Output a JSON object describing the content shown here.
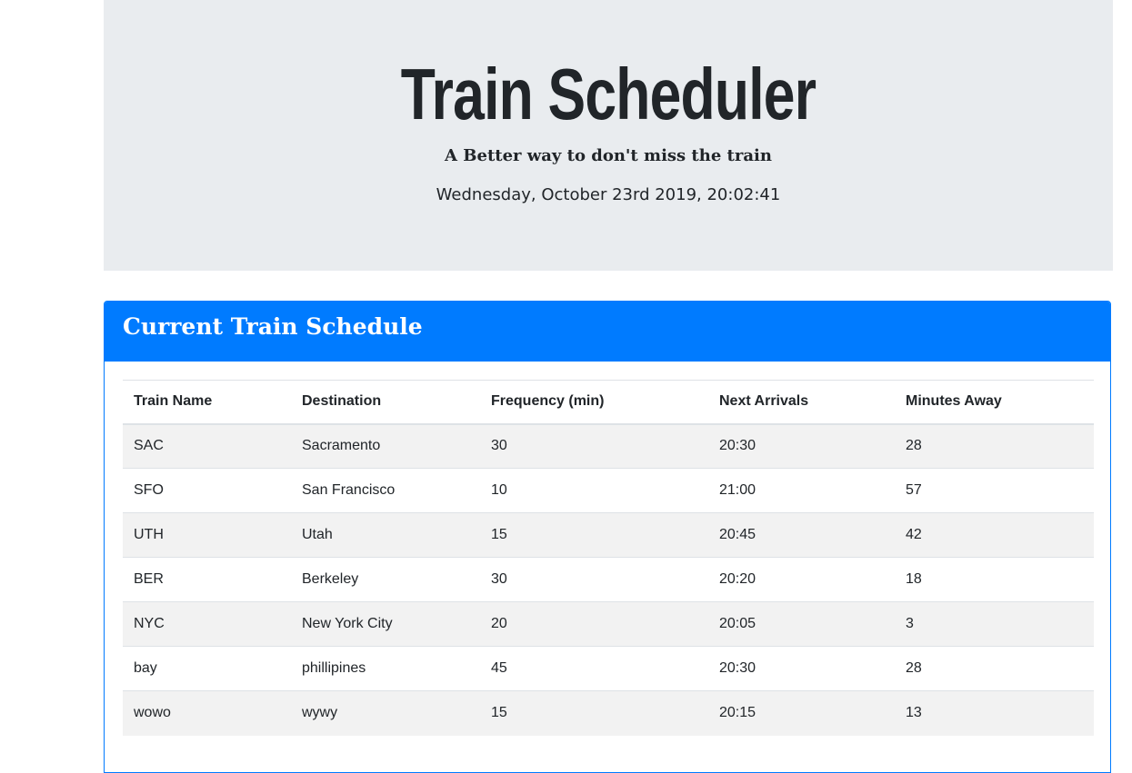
{
  "header": {
    "title": "Train Scheduler",
    "subtitle": "A Better way to don't miss the train",
    "datetime": "Wednesday, October 23rd 2019, 20:02:41"
  },
  "schedule": {
    "title": "Current Train Schedule",
    "columns": [
      "Train Name",
      "Destination",
      "Frequency (min)",
      "Next Arrivals",
      "Minutes Away"
    ],
    "rows": [
      [
        "SAC",
        "Sacramento",
        "30",
        "20:30",
        "28"
      ],
      [
        "SFO",
        "San Francisco",
        "10",
        "21:00",
        "57"
      ],
      [
        "UTH",
        "Utah",
        "15",
        "20:45",
        "42"
      ],
      [
        "BER",
        "Berkeley",
        "30",
        "20:20",
        "18"
      ],
      [
        "NYC",
        "New York City",
        "20",
        "20:05",
        "3"
      ],
      [
        "bay",
        "phillipines",
        "45",
        "20:30",
        "28"
      ],
      [
        "wowo",
        "wywy",
        "15",
        "20:15",
        "13"
      ]
    ]
  },
  "colors": {
    "primary": "#007bff",
    "jumbotron": "#e9ecef",
    "stripe": "#f2f2f2"
  }
}
